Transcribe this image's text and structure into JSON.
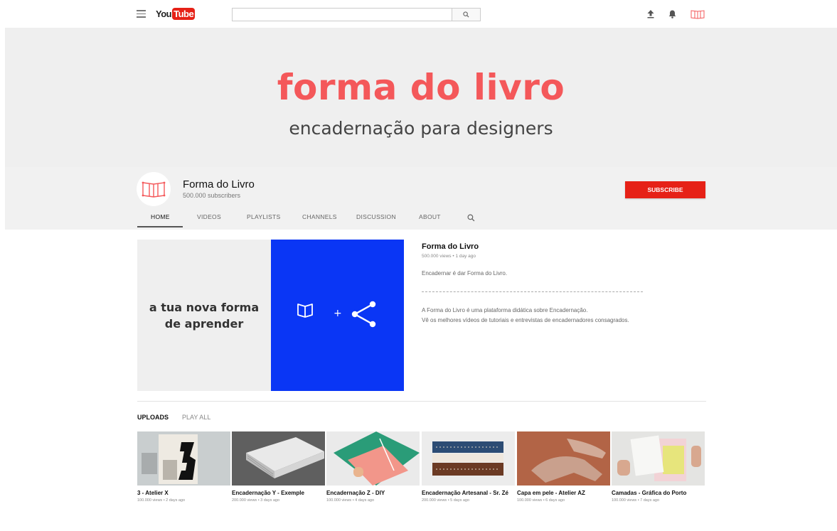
{
  "masthead": {
    "logo_you": "You",
    "logo_tube": "Tube",
    "search_placeholder": "",
    "icons": [
      "menu-icon",
      "search-icon",
      "upload-icon",
      "bell-icon",
      "account-avatar-icon"
    ]
  },
  "banner": {
    "title": "forma do livro",
    "subtitle": "encadernação para designers",
    "title_color": "#f4585a"
  },
  "channel": {
    "name": "Forma do Livro",
    "subscribers": "500.000 subscribers",
    "subscribe_label": "SUBSCRIBE",
    "tabs": [
      "HOME",
      "VIDEOS",
      "PLAYLISTS",
      "CHANNELS",
      "DISCUSSION",
      "ABOUT"
    ],
    "active_tab": "HOME"
  },
  "featured": {
    "thumb_text": "a tua nova forma de aprender",
    "thumb_plus": "+",
    "title": "Forma do Livro",
    "meta": "500.000 views • 1 day ago",
    "description_1": "Encadernar é dar Forma do Livro.",
    "description_2": "A Forma do Livro é uma plataforma didática sobre Encadernação.",
    "description_3": "Vê os melhores vídeos de tutoriais e entrevistas de encadernadores consagrados."
  },
  "uploads": {
    "heading": "UPLOADS",
    "play_all": "PLAY ALL",
    "videos": [
      {
        "title": "3 - Atelier X",
        "meta": "100.000 views • 2 days ago"
      },
      {
        "title": "Encadernação Y - Exemple",
        "meta": "200.000 views • 3 days ago"
      },
      {
        "title": "Encadernação Z - DIY",
        "meta": "100.000 views • 4 days ago"
      },
      {
        "title": "Encadernação Artesanal - Sr. Zé",
        "meta": "200.000 views • 5 days ago"
      },
      {
        "title": "Capa em pele - Atelier AZ",
        "meta": "100.000 views • 6 days ago"
      },
      {
        "title": "Camadas - Gráfica do Porto",
        "meta": "100.000 views • 7 days ago"
      }
    ]
  },
  "colors": {
    "accent_red": "#e62117",
    "feature_blue": "#0a36f5",
    "brand_coral": "#f4585a"
  }
}
